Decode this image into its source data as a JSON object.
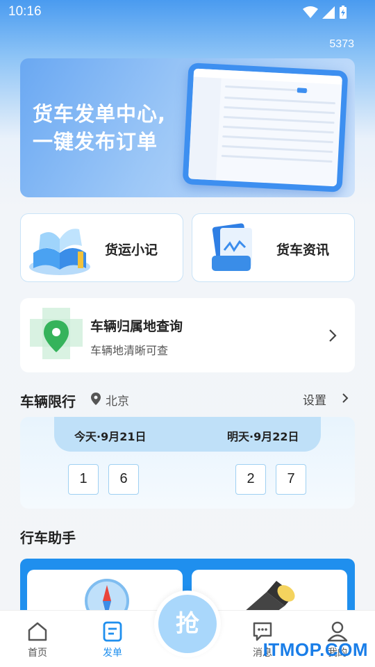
{
  "status_bar": {
    "time": "10:16"
  },
  "header": {
    "user_id": "5373"
  },
  "banner": {
    "line1": "货车发单中心,",
    "line2": "一键发布订单"
  },
  "tools": [
    {
      "label": "货运小记"
    },
    {
      "label": "货车资讯"
    }
  ],
  "vehicle_query": {
    "title": "车辆归属地查询",
    "subtitle": "车辆地清晰可查"
  },
  "restriction": {
    "title": "车辆限行",
    "city": "北京",
    "settings_label": "设置",
    "today": {
      "label": "今天·9月21日",
      "numbers": [
        "1",
        "6"
      ]
    },
    "tomorrow": {
      "label": "明天·9月22日",
      "numbers": [
        "2",
        "7"
      ]
    }
  },
  "assistant": {
    "title": "行车助手"
  },
  "tabbar": {
    "items": [
      {
        "label": "首页"
      },
      {
        "label": "发单"
      },
      {
        "label": "抢"
      },
      {
        "label": "消息"
      },
      {
        "label": "我的"
      }
    ],
    "active_color": "#1f8fee"
  },
  "watermark": "ITMOP.COM",
  "colors": {
    "accent": "#1f8fee",
    "banner_blue": "#6aa8f2"
  }
}
